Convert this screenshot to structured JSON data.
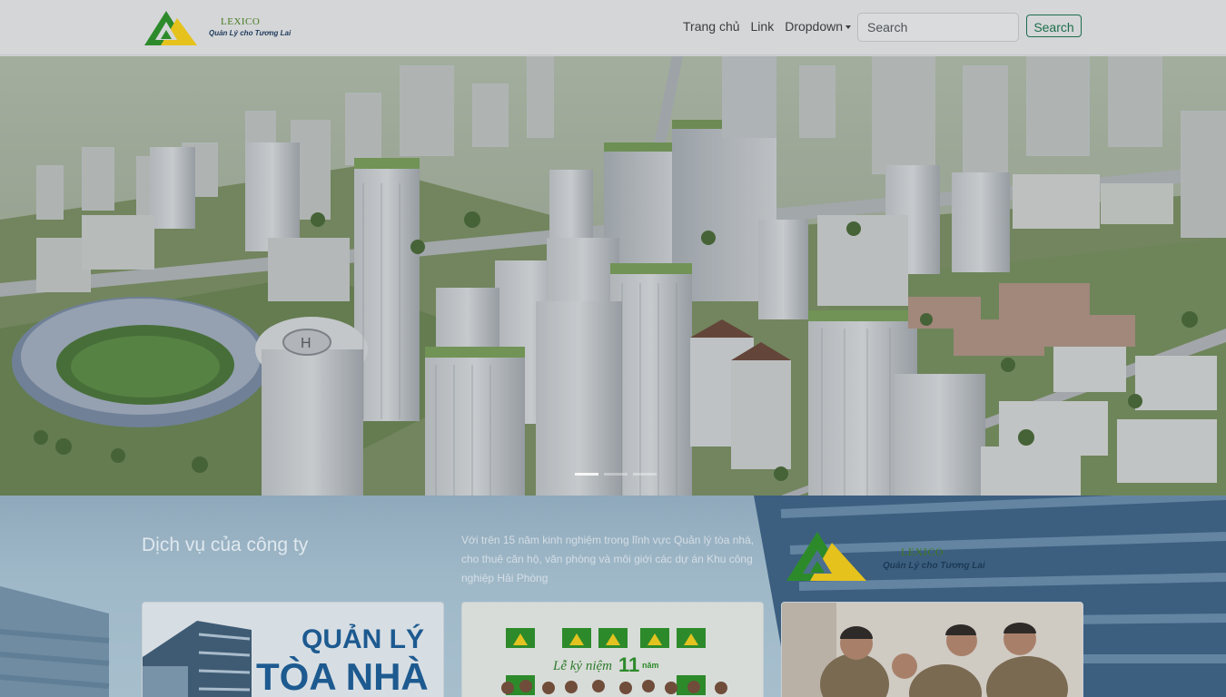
{
  "brand": {
    "name": "LEXICO",
    "tagline": "Quản Lý cho Tương Lai"
  },
  "nav": {
    "items": [
      {
        "label": "Trang chủ"
      },
      {
        "label": "Link"
      },
      {
        "label": "Dropdown"
      }
    ]
  },
  "search": {
    "placeholder": "Search",
    "button_label": "Search"
  },
  "carousel": {
    "slide_count": 3,
    "active_index": 0
  },
  "services": {
    "title": "Dịch vụ của công ty",
    "description": "Với trên 15 năm kinh nghiệm trong lĩnh vực Quản lý tòa nhà, cho thuê căn hộ, văn phòng và môi giới các dự án Khu công nghiệp Hải Phòng",
    "cards": [
      {
        "line1": "QUẢN LÝ",
        "line2": "TÒA NHÀ"
      },
      {
        "caption": "Lễ kỷ niệm",
        "number": "11",
        "unit": "năm"
      },
      {}
    ]
  },
  "colors": {
    "brand_green": "#1e6e4c",
    "logo_green": "#2c8a2a",
    "logo_yellow": "#e8c21a"
  }
}
